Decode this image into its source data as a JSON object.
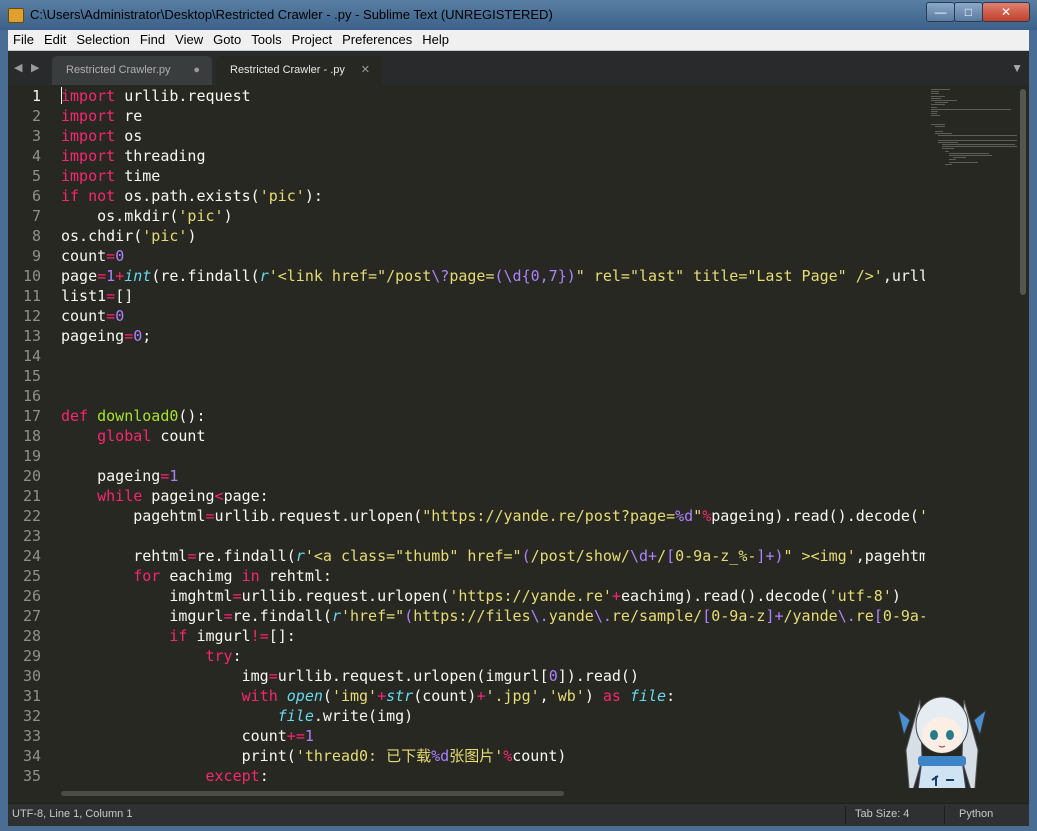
{
  "window": {
    "title": "C:\\Users\\Administrator\\Desktop\\Restricted Crawler - .py - Sublime Text (UNREGISTERED)",
    "controls": {
      "minimize": "—",
      "maximize": "□",
      "close": "✕"
    }
  },
  "menu": [
    "File",
    "Edit",
    "Selection",
    "Find",
    "View",
    "Goto",
    "Tools",
    "Project",
    "Preferences",
    "Help"
  ],
  "tabbar": {
    "nav_left": "◀",
    "nav_right": "▶",
    "overflow": "▼",
    "tabs": [
      {
        "label": "Restricted Crawler.py",
        "mark": "●",
        "active": false
      },
      {
        "label": "Restricted Crawler - .py",
        "mark": "✕",
        "active": true
      }
    ]
  },
  "editor": {
    "current_line": 1,
    "line_numbers": [
      "1",
      "2",
      "3",
      "4",
      "5",
      "6",
      "7",
      "8",
      "9",
      "10",
      "11",
      "12",
      "13",
      "14",
      "15",
      "16",
      "17",
      "18",
      "19",
      "20",
      "21",
      "22",
      "23",
      "24",
      "25",
      "26",
      "27",
      "28",
      "29",
      "30",
      "31",
      "32",
      "33",
      "34",
      "35"
    ],
    "lines": [
      "import urllib.request",
      "import re",
      "import os",
      "import threading",
      "import time",
      "if not os.path.exists('pic'):",
      "    os.mkdir('pic')",
      "os.chdir('pic')",
      "count=0",
      "page=1+int(re.findall(r'<link href=\"/post\\?page=(\\d{0,7})\" rel=\"last\" title=\"Last Page\" />',urll",
      "list1=[]",
      "count=0",
      "pageing=0;",
      "",
      "",
      "",
      "def download0():",
      "    global count",
      "",
      "    pageing=1",
      "    while pageing<page:",
      "        pagehtml=urllib.request.urlopen(\"https://yande.re/post?page=%d\"%pageing).read().decode('",
      "",
      "        rehtml=re.findall(r'<a class=\"thumb\" href=\"(/post/show/\\d+/[0-9a-z_%-]+)\" ><img',pagehtm",
      "        for eachimg in rehtml:",
      "            imghtml=urllib.request.urlopen('https://yande.re'+eachimg).read().decode('utf-8')",
      "            imgurl=re.findall(r'href=\"(https://files\\.yande\\.re/sample/[0-9a-z]+/yande\\.re[0-9a-",
      "            if imgurl!=[]:",
      "                try:",
      "                    img=urllib.request.urlopen(imgurl[0]).read()",
      "                    with open('img'+str(count)+'.jpg','wb') as file:",
      "                        file.write(img)",
      "                    count+=1",
      "                    print('thread0: 已下载%d张图片'%count)",
      "                except:"
    ]
  },
  "status": {
    "position": "UTF-8, Line 1, Column 1",
    "tab_size": "Tab Size: 4",
    "syntax": "Python"
  },
  "colors": {
    "background": "#272822",
    "keyword": "#f92672",
    "function": "#a6e22e",
    "builtin": "#66d9ef",
    "string": "#e6db74",
    "number": "#ae81ff",
    "text": "#f8f8f2"
  }
}
